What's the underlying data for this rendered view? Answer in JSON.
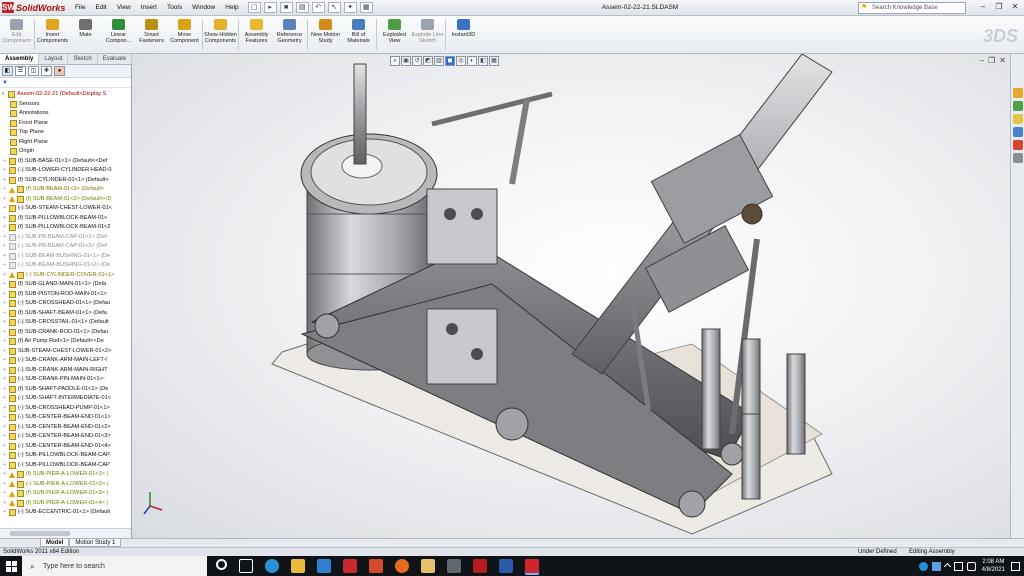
{
  "app": {
    "name": "SolidWorks",
    "logo_badge": "SW",
    "document_title": "Assem-02-22-21.SLDASM",
    "menus": [
      "File",
      "Edit",
      "View",
      "Insert",
      "Tools",
      "Window",
      "Help"
    ],
    "search_placeholder": "Search Knowledge Base"
  },
  "ribbon": {
    "buttons": [
      {
        "label": "Edit Component",
        "icon": "edit-component-icon",
        "color": "#9aa3ad",
        "enabled": false
      },
      {
        "label": "Insert Components",
        "icon": "insert-components-icon",
        "color": "#e3a31b",
        "enabled": true
      },
      {
        "label": "Mate",
        "icon": "mate-icon",
        "color": "#6f6f6f",
        "enabled": true
      },
      {
        "label": "Linear Compon...",
        "icon": "linear-pattern-icon",
        "color": "#2f8f3a",
        "enabled": true
      },
      {
        "label": "Smart Fasteners",
        "icon": "smart-fasteners-icon",
        "color": "#b99013",
        "enabled": true
      },
      {
        "label": "Move Component",
        "icon": "move-component-icon",
        "color": "#d6a316",
        "enabled": true
      },
      {
        "label": "Show Hidden Components",
        "icon": "show-hidden-icon",
        "color": "#e4b12c",
        "enabled": true
      },
      {
        "label": "Assembly Features",
        "icon": "assembly-features-icon",
        "color": "#e9b930",
        "enabled": true
      },
      {
        "label": "Reference Geometry",
        "icon": "reference-geometry-icon",
        "color": "#5d7fbf",
        "enabled": true
      },
      {
        "label": "New Motion Study",
        "icon": "motion-study-icon",
        "color": "#d08d17",
        "enabled": true
      },
      {
        "label": "Bill of Materials",
        "icon": "bill-of-materials-icon",
        "color": "#4c7bc0",
        "enabled": true
      },
      {
        "label": "Exploded View",
        "icon": "exploded-view-icon",
        "color": "#4d9e46",
        "enabled": true
      },
      {
        "label": "Explode Line Sketch",
        "icon": "explode-line-icon",
        "color": "#9aa3ad",
        "enabled": false
      },
      {
        "label": "Instant3D",
        "icon": "instant3d-icon",
        "color": "#3b71c7",
        "enabled": true
      }
    ]
  },
  "left_panel": {
    "tabs": [
      "Assembly",
      "Layout",
      "Sketch",
      "Evaluate"
    ],
    "active_tab": "Assembly",
    "tree": [
      {
        "label": "Assem-02-22-21  (Default<Display S",
        "style": "red",
        "kind": "root"
      },
      {
        "label": "Sensors",
        "kind": "flat"
      },
      {
        "label": "Annotations",
        "kind": "flat"
      },
      {
        "label": "Front Plane",
        "kind": "flat"
      },
      {
        "label": "Top Plane",
        "kind": "flat"
      },
      {
        "label": "Right Plane",
        "kind": "flat"
      },
      {
        "label": "Origin",
        "kind": "flat"
      },
      {
        "label": "(f) SUB-BASE-01<1> (Default<<Def"
      },
      {
        "label": "(-) SUB-LOWER-CYLINDER-HEAD-0"
      },
      {
        "label": "(f) SUB-CYLINDER-01<1> (Default<"
      },
      {
        "label": "(f) SUB-BEAM-01<3> (Default<",
        "style": "olive",
        "warn": true
      },
      {
        "label": "(f) SUB-BEAM-01<2> (Default<<D",
        "style": "olive",
        "warn": true
      },
      {
        "label": "(-) SUB-STEAM-CHEST-LOWER-01<"
      },
      {
        "label": "(f) SUB-PILLOWBLOCK-BEAM-01<"
      },
      {
        "label": "(f) SUB-PILLOWBLOCK-BEAM-01<2"
      },
      {
        "label": "(-) SUB-PB-BEAM-CAP-01<1> (Def",
        "style": "dim"
      },
      {
        "label": "(-) SUB-PB-BEAM-CAP-01<2> (Def",
        "style": "dim"
      },
      {
        "label": "(-) SUB-BEAM-BUSHING-01<1> (De",
        "style": "dim"
      },
      {
        "label": "(-) SUB-BEAM-BUSHING-01<2> (De",
        "style": "dim"
      },
      {
        "label": "(-) SUB-CYLINDER-COVER-01<1>",
        "style": "olive",
        "warn": true
      },
      {
        "label": "(f) SUB-GLAND-MAIN-01<1> (Defa"
      },
      {
        "label": "(f) SUB-PISTON-ROD-MAIN-01<1>"
      },
      {
        "label": "(-) SUB-CROSSHEAD-01<1> (Defau"
      },
      {
        "label": "(f) SUB-SHAFT-BEAM-01<1> (Defa"
      },
      {
        "label": "(-) SUB-CROSSTAIL-01<1> (Default"
      },
      {
        "label": "(f) SUB-CRANK-ROD-01<1> (Defau"
      },
      {
        "label": "(f) Air Pump Rod<1> (Default<<De"
      },
      {
        "label": "SUB-STEAM-CHEST-LOWER-01<2>"
      },
      {
        "label": "(-) SUB-CRANK-ARM-MAIN-LEFT-I"
      },
      {
        "label": "(-) SUB-CRANK-ARM-MAIN-RIGHT"
      },
      {
        "label": "(-) SUB-CRANK-PIN-MAIN-01<1>-"
      },
      {
        "label": "(f) SUB-SHAFT-PADDLE-01<1> (De"
      },
      {
        "label": "(-) SUB-SHAFT-INTERMEDIATE-01<"
      },
      {
        "label": "(-) SUB-CROSSHEAD-PUMP-01<1>"
      },
      {
        "label": "(-) SUB-CENTER-BEAM-END-01<1>"
      },
      {
        "label": "(-) SUB-CENTER-BEAM-END-01<2>"
      },
      {
        "label": "(-) SUB-CENTER-BEAM-END-01<3>"
      },
      {
        "label": "(-) SUB-CENTER-BEAM-END-01<4>"
      },
      {
        "label": "(-) SUB-PILLOWBLOCK-BEAM-CAP"
      },
      {
        "label": "(-) SUB-PILLOWBLOCK-BEAM-CAP"
      },
      {
        "label": "(f) SUB-PIER-A-LOWER-01<1> (",
        "style": "olive",
        "warn": true
      },
      {
        "label": "(-) SUB-PIER-A-LOWER-01<2> (",
        "style": "olive",
        "warn": true
      },
      {
        "label": "(f) SUB-PIER-A-LOWER-01<3> (",
        "style": "olive",
        "warn": true
      },
      {
        "label": "(f) SUB-PIER-A-LOWER-01<4> (",
        "style": "olive",
        "warn": true
      },
      {
        "label": "(-) SUB-ECCENTRIC-01<1> (Default"
      }
    ]
  },
  "bottom_tabs": [
    "Model",
    "Motion Study 1"
  ],
  "status": {
    "left": "SolidWorks 2011 x64 Edition",
    "state": "Under Defined",
    "mode": "Editing Assembly"
  },
  "taskbar": {
    "search_placeholder": "Type here to search",
    "time": "2:08 AM",
    "date": "4/8/2021"
  }
}
